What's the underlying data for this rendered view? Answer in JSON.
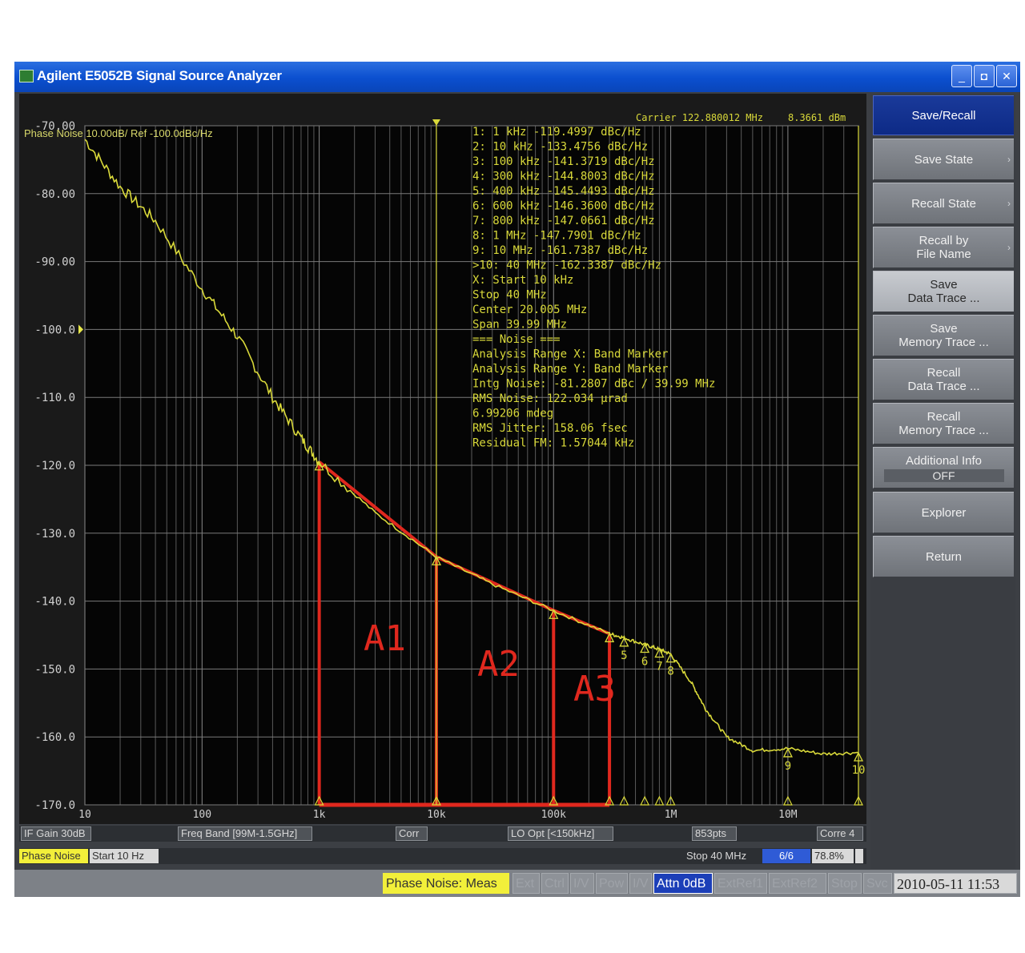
{
  "window": {
    "title": "Agilent E5052B Signal Source Analyzer",
    "buttons": [
      "_",
      "◘",
      "✕"
    ]
  },
  "plot_header": "Phase Noise 10.00dB/ Ref -100.0dBc/Hz",
  "carrier_label": "Carrier 122.880012 MHz",
  "carrier_power": "8.3661 dBm",
  "marker_table": [
    "1:   1 kHz     -119.4997 dBc/Hz",
    "2:   10 kHz    -133.4756 dBc/Hz",
    "3:   100 kHz   -141.3719 dBc/Hz",
    "4:   300 kHz   -144.8003 dBc/Hz",
    "5:   400 kHz   -145.4493 dBc/Hz",
    "6:   600 kHz   -146.3600 dBc/Hz",
    "7:   800 kHz   -147.0661 dBc/Hz",
    "8:   1 MHz     -147.7901 dBc/Hz",
    "9:   10 MHz    -161.7387 dBc/Hz",
    ">10:  40 MHz   -162.3387 dBc/Hz",
    " X:  Start 10 kHz",
    "       Stop 40 MHz",
    "     Center 20.005 MHz",
    "       Span 39.99 MHz",
    "=== Noise ===",
    "Analysis Range X: Band Marker",
    "Analysis Range Y: Band Marker",
    "Intg Noise: -81.2807 dBc / 39.99 MHz",
    "  RMS Noise: 122.034 µrad",
    "             6.99206 mdeg",
    "RMS Jitter: 158.06 fsec",
    "Residual FM: 1.57044 kHz"
  ],
  "area_labels": [
    "A1",
    "A2",
    "A3"
  ],
  "chart_data": {
    "type": "line",
    "x_scale": "log",
    "xlabel": "",
    "ylabel": "",
    "x_range": [
      10,
      40000000
    ],
    "ylim": [
      -170,
      -70
    ],
    "y_ticks": [
      "-70.00",
      "-80.00",
      "-90.00",
      "-100.0",
      "-110.0",
      "-120.0",
      "-130.0",
      "-140.0",
      "-150.0",
      "-160.0",
      "-170.0"
    ],
    "x_tick_labels": [
      "10",
      "100",
      "1k",
      "10k",
      "100k",
      "1M",
      "10M"
    ],
    "series": [
      {
        "x": [
          10,
          20,
          40,
          100,
          200,
          400,
          700,
          1000,
          3000,
          10000,
          30000,
          100000,
          300000,
          400000,
          600000,
          800000,
          1000000,
          1500000,
          2000000,
          3000000,
          5000000,
          10000000,
          20000000,
          40000000
        ],
        "y": [
          -72,
          -79,
          -84,
          -94,
          -101,
          -110,
          -116,
          -119.5,
          -127,
          -133.5,
          -137.5,
          -141.4,
          -144.8,
          -145.4,
          -146.4,
          -147.1,
          -147.8,
          -152,
          -156,
          -160,
          -162,
          -161.7,
          -162.5,
          -162.3
        ]
      }
    ],
    "markers": [
      {
        "id": "1",
        "x": 1000,
        "y": -119.4997
      },
      {
        "id": "2",
        "x": 10000,
        "y": -133.4756
      },
      {
        "id": "3",
        "x": 100000,
        "y": -141.3719
      },
      {
        "id": "4",
        "x": 300000,
        "y": -144.8003
      },
      {
        "id": "5",
        "x": 400000,
        "y": -145.4493
      },
      {
        "id": "6",
        "x": 600000,
        "y": -146.36
      },
      {
        "id": "7",
        "x": 800000,
        "y": -147.0661
      },
      {
        "id": "8",
        "x": 1000000,
        "y": -147.7901
      },
      {
        "id": "9",
        "x": 10000000,
        "y": -161.7387
      },
      {
        "id": "10",
        "x": 40000000,
        "y": -162.3387
      }
    ],
    "ref_level_label": "-100.0",
    "trace_color": "#d9d93a",
    "overlay_color": "#e0281e"
  },
  "softkeys": [
    {
      "label": "Save/Recall",
      "state": "active"
    },
    {
      "label": "Save State",
      "arrow": "›"
    },
    {
      "label": "Recall State",
      "arrow": "›"
    },
    {
      "label": "Recall by\nFile Name",
      "arrow": "›"
    },
    {
      "label": "Save\nData Trace ...",
      "state": "light"
    },
    {
      "label": "Save\nMemory Trace ..."
    },
    {
      "label": "Recall\nData Trace ..."
    },
    {
      "label": "Recall\nMemory Trace ..."
    },
    {
      "label": "Additional Info",
      "sub": "OFF"
    },
    {
      "label": "Explorer"
    },
    {
      "label": "Return"
    }
  ],
  "status1": {
    "if_gain": "IF Gain 30dB",
    "freq_band": "Freq Band [99M-1.5GHz]",
    "corr": "Corr",
    "lo_opt": "LO Opt [<150kHz]",
    "points": "853pts",
    "corre": "Corre 4"
  },
  "status2": {
    "meas": "Phase Noise",
    "start": "Start 10 Hz",
    "stop": "Stop 40 MHz",
    "count": "6/6",
    "percent": "78.8%"
  },
  "bottombar": {
    "phase_noise_meas": "Phase Noise: Meas",
    "dim1": "Ext",
    "dim2": "Ctrl",
    "dim3": "I/V",
    "dim4": "Pow",
    "dim5": "I/V",
    "attn": "Attn 0dB",
    "dim6": "ExtRef1",
    "dim7": "ExtRef2",
    "dim8": "Stop",
    "dim9": "Svc",
    "datetime": "2010-05-11 11:53"
  }
}
